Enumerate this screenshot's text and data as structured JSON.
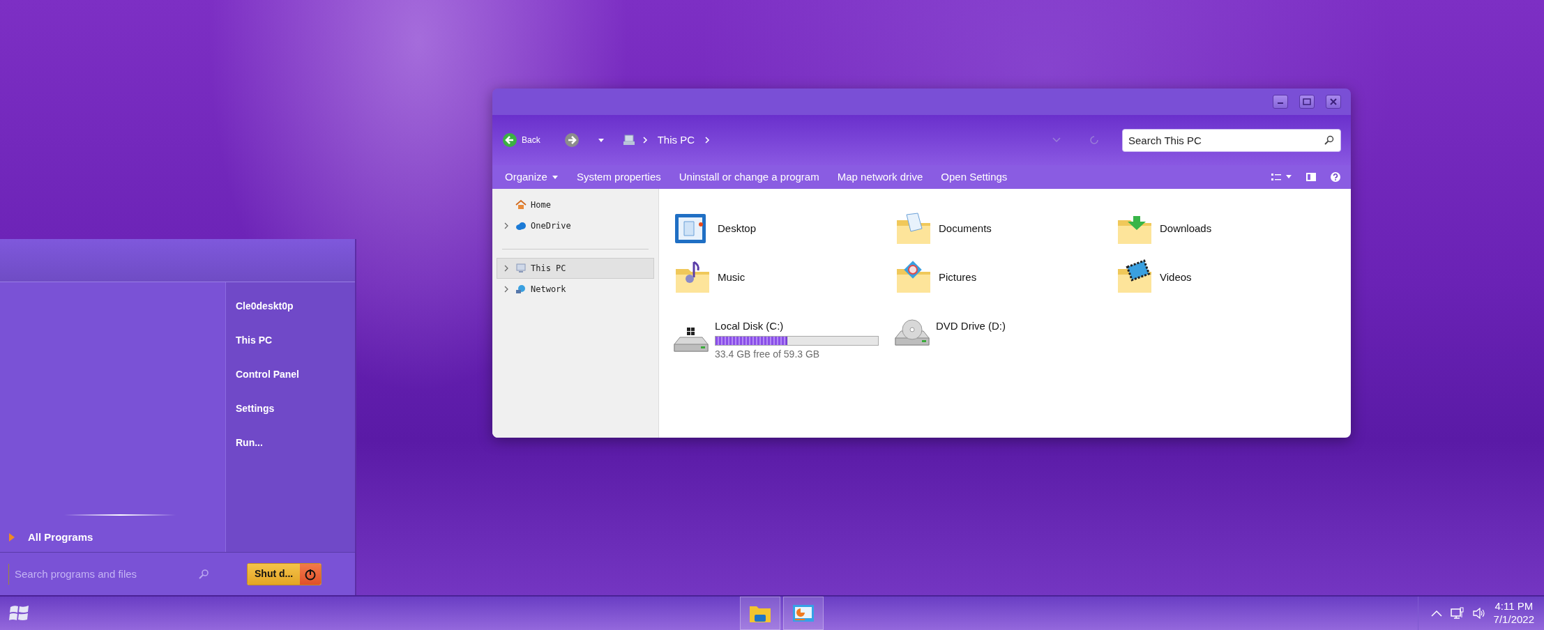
{
  "explorer": {
    "back": "Back",
    "breadcrumb": [
      "This PC"
    ],
    "search": {
      "placeholder": "Search This PC"
    },
    "commands": [
      {
        "label": "Organize",
        "dropdown": true
      },
      {
        "label": "System properties",
        "dropdown": false
      },
      {
        "label": "Uninstall or change a program",
        "dropdown": false
      },
      {
        "label": "Map network drive",
        "dropdown": false
      },
      {
        "label": "Open Settings",
        "dropdown": false
      }
    ],
    "nav": [
      {
        "label": "Home",
        "expandable": false,
        "selected": false
      },
      {
        "label": "OneDrive",
        "expandable": true,
        "selected": false
      },
      {
        "label": "This PC",
        "expandable": true,
        "selected": true
      },
      {
        "label": "Network",
        "expandable": true,
        "selected": false
      }
    ],
    "folders": [
      {
        "name": "Desktop"
      },
      {
        "name": "Documents"
      },
      {
        "name": "Downloads"
      },
      {
        "name": "Music"
      },
      {
        "name": "Pictures"
      },
      {
        "name": "Videos"
      }
    ],
    "drives": [
      {
        "kind": "disk",
        "name": "Local Disk (C:)",
        "level": 0.44,
        "free": "33.4 GB free of 59.3 GB"
      },
      {
        "kind": "dvd",
        "name": "DVD Drive (D:)"
      }
    ]
  },
  "start_menu": {
    "items": [
      "Cle0deskt0p",
      "This PC",
      "Control Panel",
      "Settings",
      "Run..."
    ],
    "all_programs": "All Programs",
    "search": {
      "placeholder": "Search programs and files"
    },
    "shutdown": "Shut d..."
  },
  "taskbar": {
    "clock": {
      "time": "4:11 PM",
      "date": "7/1/2022"
    }
  }
}
